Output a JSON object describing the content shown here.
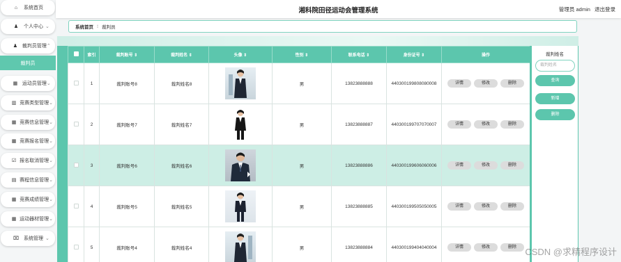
{
  "sidebar": {
    "items": [
      {
        "label": "系统首页",
        "icon": "home-icon",
        "glyph": "⌂",
        "chevron": ""
      },
      {
        "label": "个人中心",
        "icon": "user-icon",
        "glyph": "♟",
        "chevron": "⌄"
      },
      {
        "label": "裁判员管理",
        "icon": "user-icon",
        "glyph": "♟",
        "chevron": "⌃"
      },
      {
        "label": "裁判员",
        "icon": "",
        "glyph": "",
        "chevron": "",
        "active": true
      },
      {
        "label": "运动员管理",
        "icon": "grid-icon",
        "glyph": "▦",
        "chevron": "⌄"
      },
      {
        "label": "竞赛类型管理",
        "icon": "building-icon",
        "glyph": "▥",
        "chevron": "⌄"
      },
      {
        "label": "竞赛信息管理",
        "icon": "grid-icon",
        "glyph": "▦",
        "chevron": "⌄"
      },
      {
        "label": "竞赛报名管理",
        "icon": "grid-icon",
        "glyph": "▦",
        "chevron": "⌄"
      },
      {
        "label": "报名取消管理",
        "icon": "check-icon",
        "glyph": "☑",
        "chevron": "⌄"
      },
      {
        "label": "赛程信息管理",
        "icon": "calendar-icon",
        "glyph": "▤",
        "chevron": "⌄"
      },
      {
        "label": "竞赛成绩管理",
        "icon": "grid-icon",
        "glyph": "▦",
        "chevron": "⌄"
      },
      {
        "label": "运动器材管理",
        "icon": "grid-icon",
        "glyph": "▦",
        "chevron": "⌄"
      },
      {
        "label": "系统管理",
        "icon": "trash-icon",
        "glyph": "⌧",
        "chevron": "⌄"
      }
    ]
  },
  "header": {
    "title": "湘科院田径运动会管理系统",
    "user_label": "管理员 admin",
    "logout_label": "退出登录"
  },
  "breadcrumb": {
    "home": "系统首页",
    "separator": "⁝",
    "current": "裁判员"
  },
  "table": {
    "headers": [
      "索引",
      "裁判账号 ⇕",
      "裁判姓名 ⇕",
      "头像 ⇕",
      "性别 ⇕",
      "联系电话 ⇕",
      "身份证号 ⇕",
      "操作"
    ],
    "actions": [
      "详情",
      "修改",
      "删除"
    ],
    "rows": [
      {
        "index": "1",
        "account": "裁判账号8",
        "name": "裁判姓名8",
        "gender": "男",
        "phone": "13823888888",
        "id_number": "440300199808080008"
      },
      {
        "index": "2",
        "account": "裁判账号7",
        "name": "裁判姓名7",
        "gender": "男",
        "phone": "13823888887",
        "id_number": "440300199707070007"
      },
      {
        "index": "3",
        "account": "裁判账号6",
        "name": "裁判姓名6",
        "gender": "男",
        "phone": "13823888886",
        "id_number": "440300199606060006",
        "highlight": true
      },
      {
        "index": "4",
        "account": "裁判账号5",
        "name": "裁判姓名5",
        "gender": "男",
        "phone": "13823888885",
        "id_number": "440300199505050005"
      },
      {
        "index": "5",
        "account": "裁判账号4",
        "name": "裁判姓名4",
        "gender": "男",
        "phone": "13823888884",
        "id_number": "440300199404040004"
      }
    ]
  },
  "search_panel": {
    "title": "裁判姓名",
    "placeholder": "裁判姓名",
    "search_label": "查询",
    "add_label": "新增",
    "delete_label": "删除"
  },
  "watermark": "CSDN @求精程序设计",
  "colors": {
    "accent": "#5cc6ad",
    "highlight_row": "#cdeee5"
  }
}
